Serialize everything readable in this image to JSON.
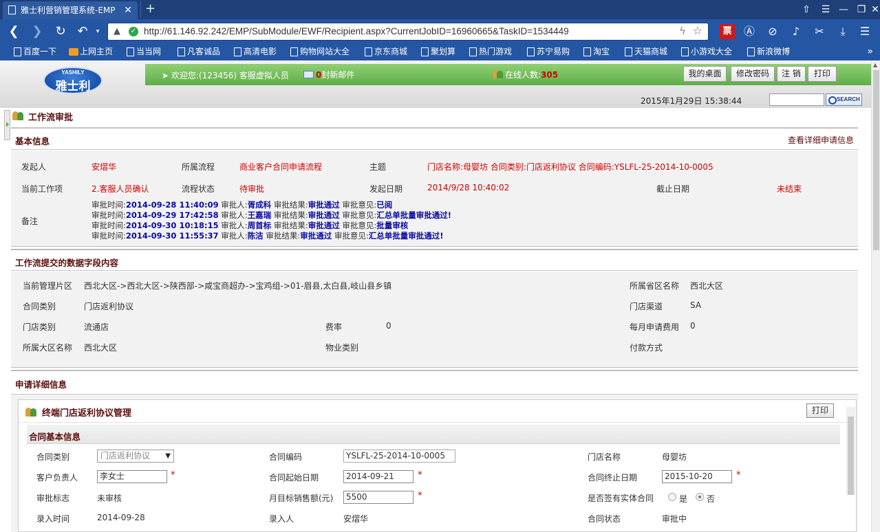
{
  "browser": {
    "tab_title": "雅士利营销管理系统-EMP",
    "url": "http://61.146.92.242/EMP/SubModule/EWF/Recipient.aspx?CurrentJobID=16960665&TaskID=1534449",
    "bookmarks": [
      "百度一下",
      "上网主页",
      "当当网",
      "凡客诚品",
      "高清电影",
      "购物网站大全",
      "京东商城",
      "聚划算",
      "热门游戏",
      "苏宁易购",
      "淘宝",
      "天猫商城",
      "小游戏大全",
      "新浪微博"
    ]
  },
  "header": {
    "logo_en": "YASHILY",
    "logo_cn": "雅士利",
    "welcome": "欢迎您:(123456) 客服虚拟人员",
    "mail_count": "0",
    "mail_text": "封新邮件",
    "online_label": "在线人数:",
    "online_count": "305",
    "buttons": [
      "我的桌面",
      "修改密码",
      "注 销",
      "打印"
    ],
    "datetime": "2015年1月29日 15:38:44",
    "search_btn": "SEARCH"
  },
  "workflow": {
    "title": "工作流审批",
    "basic_title": "基本信息",
    "detail_link": "查看详细申请信息",
    "fields": {
      "initiator_label": "发起人",
      "initiator": "安熠华",
      "process_label": "所属流程",
      "process": "商业客户合同申请流程",
      "subject_label": "主题",
      "subject": "门店名称:母婴坊 合同类别:门店返利协议 合同编码:YSLFL-25-2014-10-0005",
      "current_label": "当前工作项",
      "current": "2.客服人员确认",
      "status_label": "流程状态",
      "status": "待审批",
      "start_label": "发起日期",
      "start": "2014/9/28 10:40:02",
      "deadline_label": "截止日期",
      "deadline": "未结束",
      "remark_label": "备注"
    },
    "remarks": [
      {
        "p1": "审批时间:",
        "time": "2014-09-28 11:40:09",
        "p2": " 审批人:",
        "who": "胥成科",
        "p3": " 审批结果:",
        "result": "审批通过",
        "p4": " 审批意见:",
        "opinion": "已阅"
      },
      {
        "p1": "审批时间:",
        "time": "2014-09-29 17:42:58",
        "p2": " 审批人:",
        "who": "王嘉瑞",
        "p3": " 审批结果:",
        "result": "审批通过",
        "p4": " 审批意见:",
        "opinion": "汇总单批量审批通过!"
      },
      {
        "p1": "审批时间:",
        "time": "2014-09-30 10:18:15",
        "p2": " 审批人:",
        "who": "周首标",
        "p3": " 审批结果:",
        "result": "审批通过",
        "p4": " 审批意见:",
        "opinion": "批量审核"
      },
      {
        "p1": "审批时间:",
        "time": "2014-09-30 11:55:37",
        "p2": " 审批人:",
        "who": "陈洁",
        "p3": " 审批结果:",
        "result": "审批通过",
        "p4": " 审批意见:",
        "opinion": "汇总单批量审批通过!"
      }
    ]
  },
  "data_fields": {
    "title": "工作流提交的数据字段内容",
    "area_label": "当前管理片区",
    "area": "西北大区->西北大区->陕西部->咸宝商超办->宝鸡组->01-眉县,太白县,岐山县乡镇",
    "province_label": "所属省区名称",
    "province": "西北大区",
    "contract_type_label": "合同类别",
    "contract_type": "门店返利协议",
    "channel_label": "门店渠道",
    "channel": "SA",
    "store_type_label": "门店类别",
    "store_type": "流通店",
    "rate_label": "费率",
    "rate": "0",
    "monthly_label": "每月申请费用",
    "monthly": "0",
    "region_label": "所属大区名称",
    "region": "西北大区",
    "property_label": "物业类别",
    "payment_label": "付款方式"
  },
  "detail": {
    "title": "申请详细信息",
    "panel_title": "终端门店返利协议管理",
    "print": "打印",
    "section": "合同基本信息",
    "type_label": "合同类别",
    "type": "门店返利协议",
    "code_label": "合同编码",
    "code": "YSLFL-25-2014-10-0005",
    "store_label": "门店名称",
    "store": "母婴坊",
    "owner_label": "客户负责人",
    "owner": "李女士",
    "begin_label": "合同起始日期",
    "begin": "2014-09-21",
    "end_label": "合同终止日期",
    "end": "2015-10-20",
    "audit_label": "审批标志",
    "audit": "未审核",
    "target_label": "月目标销售额(元)",
    "target": "5500",
    "signed_label": "是否签有实体合同",
    "yes": "是",
    "no": "否",
    "entry_time_label": "录入时间",
    "entry_time": "2014-09-28",
    "entry_by_label": "录入人",
    "entry_by": "安熠华",
    "state_label": "合同状态",
    "state": "审批中"
  }
}
